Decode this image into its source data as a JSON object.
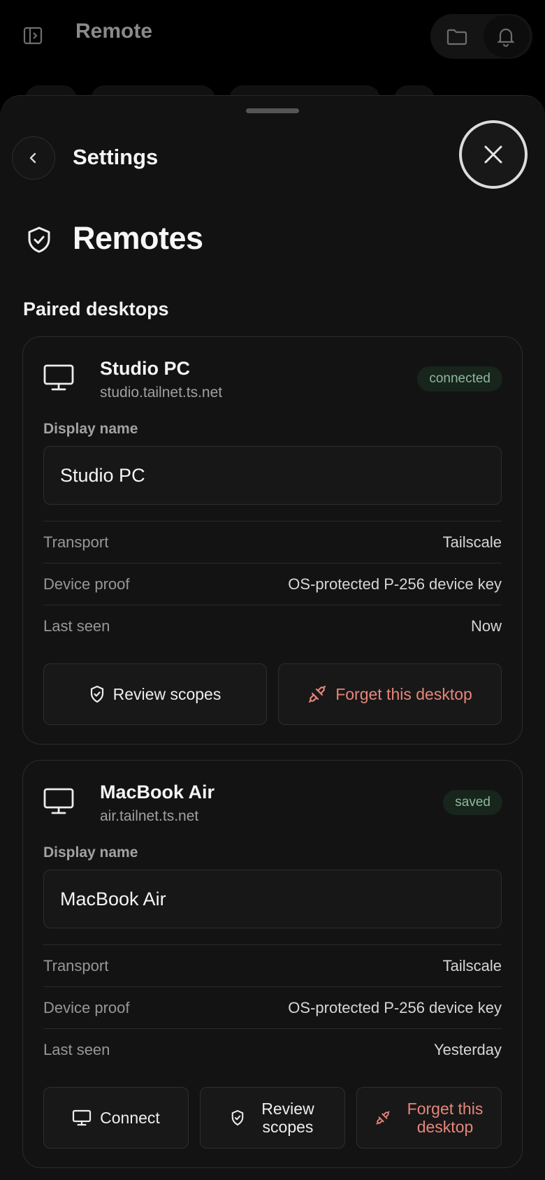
{
  "app": {
    "title": "Remote"
  },
  "sheet": {
    "title": "Settings",
    "section_title": "Remotes",
    "subsection_title": "Paired desktops"
  },
  "desktops": [
    {
      "name": "Studio PC",
      "host": "studio.tailnet.ts.net",
      "status": "connected",
      "display_name_label": "Display name",
      "display_name_value": "Studio PC",
      "rows": [
        {
          "label": "Transport",
          "value": "Tailscale"
        },
        {
          "label": "Device proof",
          "value": "OS-protected P-256 device key"
        },
        {
          "label": "Last seen",
          "value": "Now"
        }
      ],
      "actions": {
        "review": "Review scopes",
        "forget": "Forget this desktop"
      }
    },
    {
      "name": "MacBook Air",
      "host": "air.tailnet.ts.net",
      "status": "saved",
      "display_name_label": "Display name",
      "display_name_value": "MacBook Air",
      "rows": [
        {
          "label": "Transport",
          "value": "Tailscale"
        },
        {
          "label": "Device proof",
          "value": "OS-protected P-256 device key"
        },
        {
          "label": "Last seen",
          "value": "Yesterday"
        }
      ],
      "actions": {
        "connect": "Connect",
        "review_line1": "Review",
        "review_line2": "scopes",
        "forget_line1": "Forget this",
        "forget_line2": "desktop"
      }
    }
  ],
  "colors": {
    "background": "#121212",
    "danger": "#e8857a",
    "badge_text": "#8fb79c",
    "badge_bg": "#17251d"
  },
  "icons": {
    "sidebar": "sidebar-toggle-icon",
    "folder": "folder-icon",
    "bell": "bell-icon",
    "back": "chevron-left-icon",
    "close": "close-icon",
    "section": "shield-check-icon",
    "desktop": "monitor-icon",
    "forget": "unplug-icon"
  }
}
